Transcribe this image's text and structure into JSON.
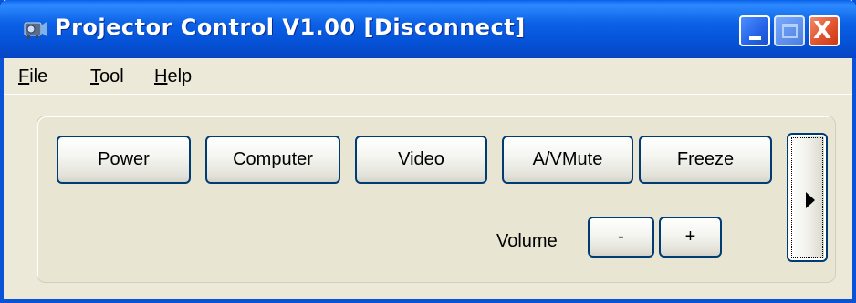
{
  "window": {
    "title": "Projector Control V1.00 [Disconnect]",
    "controls": {
      "minimize": "minimize",
      "maximize": "maximize",
      "close": "X"
    }
  },
  "menubar": {
    "items": [
      {
        "accel": "F",
        "rest": "ile"
      },
      {
        "accel": "T",
        "rest": "ool"
      },
      {
        "accel": "H",
        "rest": "elp"
      }
    ]
  },
  "controls": {
    "buttons": [
      "Power",
      "Computer",
      "Video",
      "A/VMute",
      "Freeze"
    ],
    "volume": {
      "label": "Volume",
      "down": "-",
      "up": "+"
    },
    "expand_icon": "triangle-right"
  },
  "colors": {
    "titlebar": "#0A52D6",
    "window_bg": "#ECE9D8",
    "button_border": "#003C74",
    "close_button": "#E0502A"
  }
}
